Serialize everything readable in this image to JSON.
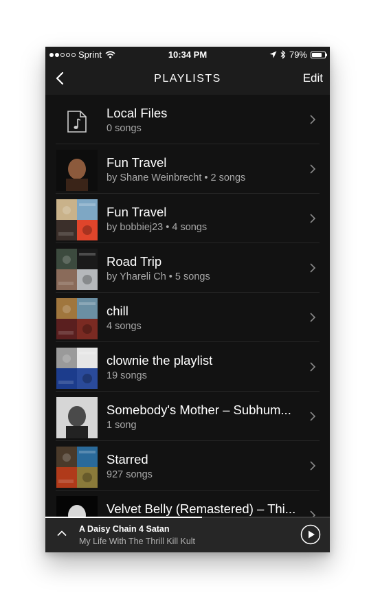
{
  "status_bar": {
    "carrier": "Sprint",
    "time": "10:34 PM",
    "battery_percent": "79%",
    "battery_level": 0.79,
    "signal_bars_filled": 2,
    "signal_bars_total": 5,
    "icons": [
      "wifi-icon",
      "location-arrow-icon",
      "bluetooth-icon",
      "battery-icon"
    ]
  },
  "nav": {
    "back_icon": "chevron-left-icon",
    "title": "PLAYLISTS",
    "edit_label": "Edit"
  },
  "playlists": [
    {
      "title": "Local Files",
      "subtitle": "0 songs",
      "thumb": "music-file-icon"
    },
    {
      "title": "Fun Travel",
      "subtitle": "by Shane Weinbrecht • 2 songs",
      "thumb": "single-cover",
      "colors": [
        "#0d0d0d",
        "#8c5a3c",
        "#3a2418"
      ]
    },
    {
      "title": "Fun Travel",
      "subtitle": "by bobbiej23 • 4 songs",
      "thumb": "mosaic",
      "colors": [
        "#c9b28a",
        "#7ea7c4",
        "#3b2f2a",
        "#e0452b"
      ]
    },
    {
      "title": "Road Trip",
      "subtitle": "by Yhareli Ch • 5 songs",
      "thumb": "mosaic",
      "colors": [
        "#3c4a3e",
        "#1a1a1a",
        "#8a6b5a",
        "#b5b8bb"
      ]
    },
    {
      "title": "chill",
      "subtitle": "4 songs",
      "thumb": "mosaic",
      "colors": [
        "#a0763d",
        "#6b8fa3",
        "#5a1f1f",
        "#7a2a22"
      ]
    },
    {
      "title": "clownie the playlist",
      "subtitle": "19 songs",
      "thumb": "mosaic",
      "colors": [
        "#9a9a9a",
        "#e6e6e6",
        "#1c3c8c",
        "#2a4a9a"
      ]
    },
    {
      "title": "Somebody's Mother – Subhum...",
      "subtitle": "1 song",
      "thumb": "single-cover",
      "colors": [
        "#d6d6d6",
        "#4a4a4a",
        "#222222"
      ]
    },
    {
      "title": "Starred",
      "subtitle": "927 songs",
      "thumb": "mosaic",
      "colors": [
        "#4a3a2a",
        "#2a6a9a",
        "#b03a1a",
        "#8a7a3a"
      ]
    },
    {
      "title": "Velvet Belly (Remastered) – Thi...",
      "subtitle": "",
      "thumb": "single-cover",
      "colors": [
        "#050505",
        "#d8d8d8",
        "#3a3a3a"
      ]
    }
  ],
  "player": {
    "track_title": "A Daisy Chain 4 Satan",
    "artist": "My Life With The Thrill Kill Kult",
    "progress": 0.55,
    "up_icon": "chevron-up-icon",
    "play_icon": "play-circle-icon"
  }
}
